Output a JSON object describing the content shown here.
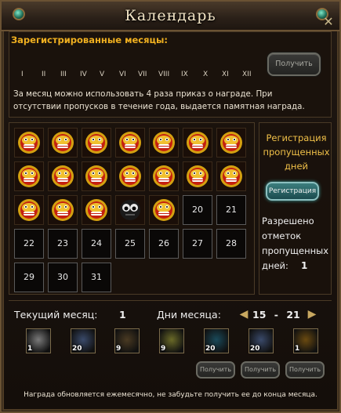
{
  "window": {
    "title": "Календарь"
  },
  "months": {
    "title": "Зарегистрированные месяцы:",
    "numerals": [
      "I",
      "II",
      "III",
      "IV",
      "V",
      "VI",
      "VII",
      "VIII",
      "IX",
      "X",
      "XI",
      "XII"
    ],
    "get_label": "Получить",
    "description": "За месяц можно использовать 4 раза приказ о награде. При отсутствии пропусков в течение года, выдается памятная награда."
  },
  "calendar": {
    "days": [
      {
        "label": "",
        "state": "stamped"
      },
      {
        "label": "",
        "state": "stamped"
      },
      {
        "label": "",
        "state": "stamped"
      },
      {
        "label": "",
        "state": "stamped"
      },
      {
        "label": "",
        "state": "stamped"
      },
      {
        "label": "",
        "state": "stamped"
      },
      {
        "label": "",
        "state": "stamped"
      },
      {
        "label": "",
        "state": "stamped"
      },
      {
        "label": "",
        "state": "stamped"
      },
      {
        "label": "",
        "state": "stamped"
      },
      {
        "label": "",
        "state": "stamped"
      },
      {
        "label": "",
        "state": "stamped"
      },
      {
        "label": "",
        "state": "stamped"
      },
      {
        "label": "",
        "state": "stamped"
      },
      {
        "label": "",
        "state": "stamped"
      },
      {
        "label": "",
        "state": "stamped"
      },
      {
        "label": "",
        "state": "stamped"
      },
      {
        "label": "",
        "state": "missed"
      },
      {
        "label": "",
        "state": "stamped"
      },
      {
        "label": "20",
        "state": "empty"
      },
      {
        "label": "21",
        "state": "empty"
      },
      {
        "label": "22",
        "state": "empty"
      },
      {
        "label": "23",
        "state": "empty"
      },
      {
        "label": "24",
        "state": "empty"
      },
      {
        "label": "25",
        "state": "empty"
      },
      {
        "label": "26",
        "state": "empty"
      },
      {
        "label": "27",
        "state": "empty"
      },
      {
        "label": "28",
        "state": "empty"
      },
      {
        "label": "29",
        "state": "empty"
      },
      {
        "label": "30",
        "state": "empty"
      },
      {
        "label": "31",
        "state": "empty"
      }
    ]
  },
  "side": {
    "title": "Регистрация пропущенных дней",
    "register_label": "Регистрация",
    "allowed_text": "Разрешено отметок пропущенных дней:",
    "allowed_count": "1"
  },
  "footer": {
    "current_month_label": "Текущий месяц:",
    "current_month_value": "1",
    "days_label": "Дни месяца:",
    "range_start": "15",
    "range_sep": "-",
    "range_end": "21",
    "rewards": [
      {
        "icon": "scroll-icon",
        "count": "1",
        "color": "#7a7a7a"
      },
      {
        "icon": "swirl-horn-icon",
        "count": "20",
        "color": "#3a4a6a"
      },
      {
        "icon": "parchment-icon",
        "count": "9",
        "color": "#4a3a22"
      },
      {
        "icon": "yellow-scroll-icon",
        "count": "9",
        "color": "#6a6a28"
      },
      {
        "icon": "gem-chest-icon",
        "count": "20",
        "color": "#1a4a5a"
      },
      {
        "icon": "swirl-horn-icon",
        "count": "20",
        "color": "#3a4a6a"
      },
      {
        "icon": "book-icon",
        "count": "1",
        "color": "#6a4a10"
      }
    ],
    "get_label": "Получить",
    "note": "Награда обновляется ежемесячно, не забудьте получить ее до конца месяца."
  }
}
